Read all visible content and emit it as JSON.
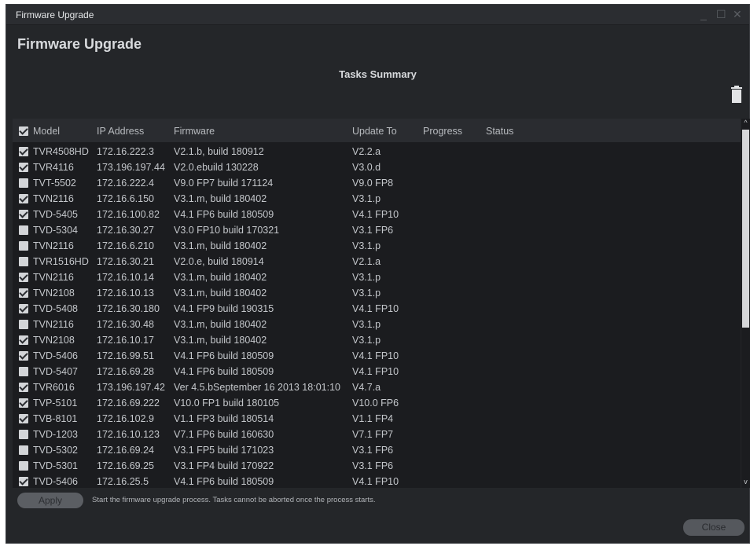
{
  "window": {
    "title": "Firmware Upgrade"
  },
  "page": {
    "heading": "Firmware Upgrade",
    "section": "Tasks Summary"
  },
  "table": {
    "headers": {
      "model": "Model",
      "ip": "IP Address",
      "firmware": "Firmware",
      "update_to": "Update To",
      "progress": "Progress",
      "status": "Status"
    },
    "select_all_checked": true,
    "rows": [
      {
        "checked": true,
        "model": "TVR4508HD",
        "ip": "172.16.222.3",
        "firmware": "V2.1.b, build 180912",
        "update_to": "V2.2.a"
      },
      {
        "checked": true,
        "model": "TVR4116",
        "ip": "173.196.197.44",
        "firmware": "V2.0.ebuild 130228",
        "update_to": "V3.0.d"
      },
      {
        "checked": false,
        "model": "TVT-5502",
        "ip": "172.16.222.4",
        "firmware": "V9.0 FP7 build 171124",
        "update_to": "V9.0 FP8"
      },
      {
        "checked": true,
        "model": "TVN2116",
        "ip": "172.16.6.150",
        "firmware": "V3.1.m, build 180402",
        "update_to": "V3.1.p"
      },
      {
        "checked": true,
        "model": "TVD-5405",
        "ip": "172.16.100.82",
        "firmware": "V4.1 FP6 build 180509",
        "update_to": "V4.1 FP10"
      },
      {
        "checked": false,
        "model": "TVD-5304",
        "ip": "172.16.30.27",
        "firmware": "V3.0 FP10 build 170321",
        "update_to": "V3.1 FP6"
      },
      {
        "checked": false,
        "model": "TVN2116",
        "ip": "172.16.6.210",
        "firmware": "V3.1.m, build 180402",
        "update_to": "V3.1.p"
      },
      {
        "checked": false,
        "model": "TVR1516HD",
        "ip": "172.16.30.21",
        "firmware": "V2.0.e, build 180914",
        "update_to": "V2.1.a"
      },
      {
        "checked": true,
        "model": "TVN2116",
        "ip": "172.16.10.14",
        "firmware": "V3.1.m, build 180402",
        "update_to": "V3.1.p"
      },
      {
        "checked": true,
        "model": "TVN2108",
        "ip": "172.16.10.13",
        "firmware": "V3.1.m, build 180402",
        "update_to": "V3.1.p"
      },
      {
        "checked": true,
        "model": "TVD-5408",
        "ip": "172.16.30.180",
        "firmware": "V4.1 FP9 build 190315",
        "update_to": "V4.1 FP10"
      },
      {
        "checked": false,
        "model": "TVN2116",
        "ip": "172.16.30.48",
        "firmware": "V3.1.m, build 180402",
        "update_to": "V3.1.p"
      },
      {
        "checked": true,
        "model": "TVN2108",
        "ip": "172.16.10.17",
        "firmware": "V3.1.m, build 180402",
        "update_to": "V3.1.p"
      },
      {
        "checked": true,
        "model": "TVD-5406",
        "ip": "172.16.99.51",
        "firmware": "V4.1 FP6 build 180509",
        "update_to": "V4.1 FP10"
      },
      {
        "checked": false,
        "model": "TVD-5407",
        "ip": "172.16.69.28",
        "firmware": "V4.1 FP6 build 180509",
        "update_to": "V4.1 FP10"
      },
      {
        "checked": true,
        "model": "TVR6016",
        "ip": "173.196.197.42",
        "firmware": "Ver 4.5.bSeptember 16 2013 18:01:10",
        "update_to": "V4.7.a"
      },
      {
        "checked": true,
        "model": "TVP-5101",
        "ip": "172.16.69.222",
        "firmware": "V10.0 FP1 build 180105",
        "update_to": "V10.0 FP6"
      },
      {
        "checked": true,
        "model": "TVB-8101",
        "ip": "172.16.102.9",
        "firmware": "V1.1 FP3 build 180514",
        "update_to": "V1.1 FP4"
      },
      {
        "checked": false,
        "model": "TVD-1203",
        "ip": "172.16.10.123",
        "firmware": "V7.1 FP6 build 160630",
        "update_to": "V7.1 FP7"
      },
      {
        "checked": false,
        "model": "TVD-5302",
        "ip": "172.16.69.24",
        "firmware": "V3.1 FP5 build 171023",
        "update_to": "V3.1 FP6"
      },
      {
        "checked": false,
        "model": "TVD-5301",
        "ip": "172.16.69.25",
        "firmware": "V3.1 FP4 build 170922",
        "update_to": "V3.1 FP6"
      },
      {
        "checked": true,
        "model": "TVD-5406",
        "ip": "172.16.25.5",
        "firmware": "V4.1 FP6 build 180509",
        "update_to": "V4.1 FP10"
      }
    ]
  },
  "footer": {
    "apply_label": "Apply",
    "note": "Start the firmware upgrade process.  Tasks cannot be aborted once the process starts.",
    "close_label": "Close"
  },
  "icons": {
    "delete": "trash-icon",
    "minimize": "minimize-icon",
    "maximize": "maximize-icon",
    "close": "close-icon"
  }
}
